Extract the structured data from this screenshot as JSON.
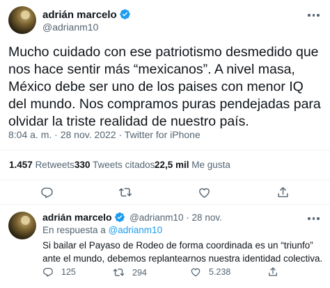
{
  "main_tweet": {
    "author_name": "adrián marcelo",
    "handle": "@adrianm10",
    "text": "Mucho cuidado con ese patriotismo desmedido que nos hace sentir más “mexicanos”. A nivel masa, México debe ser uno de los paises con menor IQ del mundo. Nos compramos puras pendejadas para olvidar la triste realidad de nuestro país.",
    "timestamp": "8:04 a. m. · 28 nov. 2022 · Twitter for iPhone",
    "stats": {
      "retweets_count": "1.457",
      "retweets_label": "Retweets",
      "quotes_count": "330",
      "quotes_label": "Tweets citados",
      "likes_count": "22,5 mil",
      "likes_label": "Me gusta"
    },
    "actions": [
      "reply-icon",
      "retweet-icon",
      "like-icon",
      "share-icon"
    ]
  },
  "reply_tweet": {
    "author_name": "adrián marcelo",
    "handle_date": "@adrianm10 · 28 nov.",
    "in_reply_prefix": "En respuesta a",
    "in_reply_handle": "@adrianm10",
    "text": "Si bailar el Payaso de Rodeo de forma coordinada es un “triunfo” ante el mundo, debemos replantearnos nuestra identidad colectiva.",
    "reply_count": "125",
    "retweet_count": "294",
    "like_count": "5.238"
  },
  "colors": {
    "accent": "#1d9bf0",
    "text": "#0f1419",
    "muted": "#536471",
    "divider": "#eff3f4"
  }
}
